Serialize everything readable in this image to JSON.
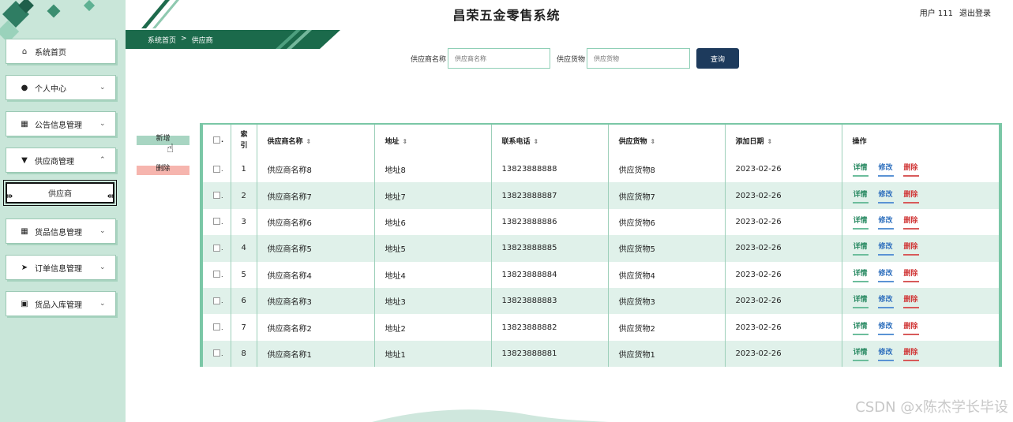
{
  "app": {
    "title": "昌荣五金零售系统"
  },
  "user": {
    "label": "用户 111",
    "logout": "退出登录"
  },
  "breadcrumb": {
    "home": "系统首页",
    "separator": ">",
    "current": "供应商"
  },
  "sidebar": {
    "items": [
      {
        "label": "系统首页",
        "icon": "home-icon"
      },
      {
        "label": "个人中心",
        "icon": "user-icon"
      },
      {
        "label": "公告信息管理",
        "icon": "grid-icon"
      },
      {
        "label": "供应商管理",
        "icon": "supplier-icon"
      },
      {
        "label": "货品信息管理",
        "icon": "grid-icon"
      },
      {
        "label": "订单信息管理",
        "icon": "send-icon"
      },
      {
        "label": "货品入库管理",
        "icon": "clipboard-icon"
      }
    ],
    "subitem": "供应商"
  },
  "search": {
    "name_label": "供应商名称",
    "name_placeholder": "供应商名称",
    "goods_label": "供应货物",
    "goods_placeholder": "供应货物",
    "button": "查询"
  },
  "actions": {
    "add": "新增",
    "delete": "删除"
  },
  "table": {
    "headers": {
      "index": "索引",
      "name": "供应商名称",
      "address": "地址",
      "phone": "联系电话",
      "goods": "供应货物",
      "date": "添加日期",
      "ops": "操作"
    },
    "rows": [
      {
        "index": "1",
        "name": "供应商名称8",
        "address": "地址8",
        "phone": "13823888888",
        "goods": "供应货物8",
        "date": "2023-02-26"
      },
      {
        "index": "2",
        "name": "供应商名称7",
        "address": "地址7",
        "phone": "13823888887",
        "goods": "供应货物7",
        "date": "2023-02-26"
      },
      {
        "index": "3",
        "name": "供应商名称6",
        "address": "地址6",
        "phone": "13823888886",
        "goods": "供应货物6",
        "date": "2023-02-26"
      },
      {
        "index": "4",
        "name": "供应商名称5",
        "address": "地址5",
        "phone": "13823888885",
        "goods": "供应货物5",
        "date": "2023-02-26"
      },
      {
        "index": "5",
        "name": "供应商名称4",
        "address": "地址4",
        "phone": "13823888884",
        "goods": "供应货物4",
        "date": "2023-02-26"
      },
      {
        "index": "6",
        "name": "供应商名称3",
        "address": "地址3",
        "phone": "13823888883",
        "goods": "供应货物3",
        "date": "2023-02-26"
      },
      {
        "index": "7",
        "name": "供应商名称2",
        "address": "地址2",
        "phone": "13823888882",
        "goods": "供应货物2",
        "date": "2023-02-26"
      },
      {
        "index": "8",
        "name": "供应商名称1",
        "address": "地址1",
        "phone": "13823888881",
        "goods": "供应货物1",
        "date": "2023-02-26"
      }
    ],
    "row_ops": {
      "detail": "详情",
      "edit": "修改",
      "delete": "删除"
    }
  },
  "watermark": "CSDN @x陈杰学长毕设",
  "colors": {
    "accent": "#7ac7a6",
    "sidebar": "#c9e6d9",
    "search_button": "#1d3a5c",
    "delete_color": "#d13838",
    "edit_color": "#2e6fbd"
  }
}
